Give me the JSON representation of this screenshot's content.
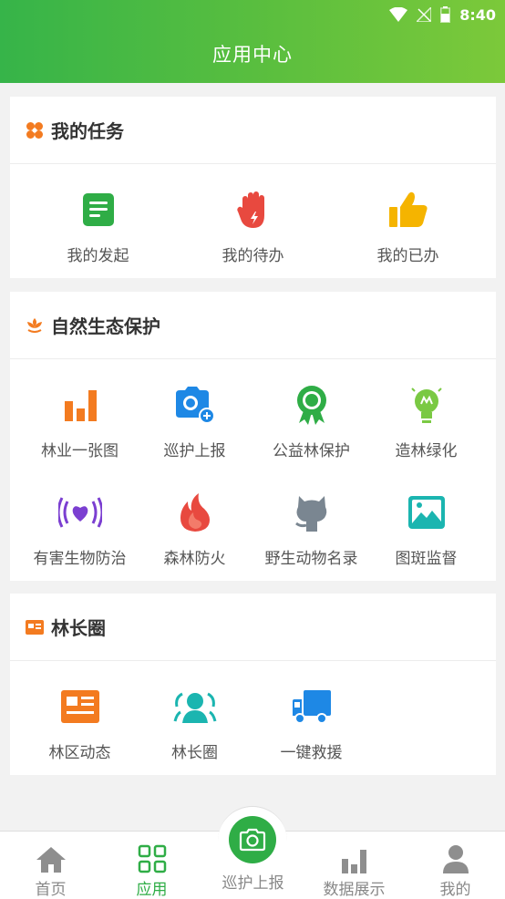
{
  "status": {
    "time": "8:40"
  },
  "header": {
    "title": "应用中心"
  },
  "sections": {
    "tasks": {
      "title": "我的任务",
      "items": [
        "我的发起",
        "我的待办",
        "我的已办"
      ]
    },
    "ecology": {
      "title": "自然生态保护",
      "items": [
        "林业一张图",
        "巡护上报",
        "公益林保护",
        "造林绿化",
        "有害生物防治",
        "森林防火",
        "野生动物名录",
        "图斑监督"
      ]
    },
    "circle": {
      "title": "林长圈",
      "items": [
        "林区动态",
        "林长圈",
        "一键救援"
      ]
    }
  },
  "tabbar": {
    "home": "首页",
    "apps": "应用",
    "patrol": "巡护上报",
    "data": "数据展示",
    "mine": "我的",
    "active": "apps"
  },
  "colors": {
    "brand_green": "#2fad46",
    "orange": "#f37b20",
    "red": "#e8493f",
    "blue": "#1e88e5",
    "yellow": "#f5b400",
    "teal": "#1bb5b0",
    "purple": "#7b3fd1"
  }
}
